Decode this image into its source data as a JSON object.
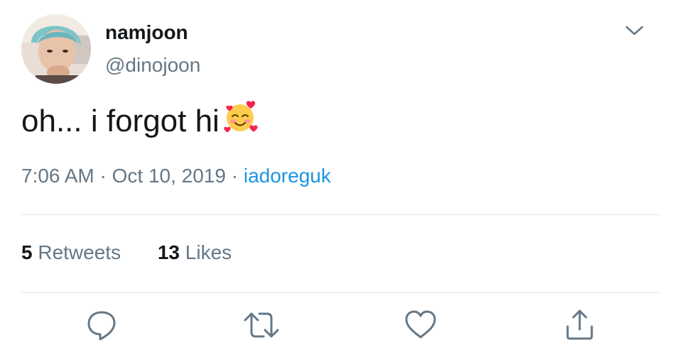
{
  "tweet": {
    "author": {
      "name": "namjoon",
      "handle": "@dinojoon"
    },
    "text": "oh... i forgot hi",
    "emoji": "smiling-face-with-hearts-icon",
    "time": "7:06 AM",
    "date": "Oct 10, 2019",
    "separator": "·",
    "source": "iadoreguk",
    "retweets": {
      "count": "5",
      "label": "Retweets"
    },
    "likes": {
      "count": "13",
      "label": "Likes"
    }
  },
  "colors": {
    "secondary_text": "#657786",
    "link": "#1b95e0",
    "divider": "#e1e8ed",
    "icon": "#657786"
  },
  "icons": [
    "chevron-down-icon",
    "reply-icon",
    "retweet-icon",
    "like-icon",
    "share-icon"
  ]
}
